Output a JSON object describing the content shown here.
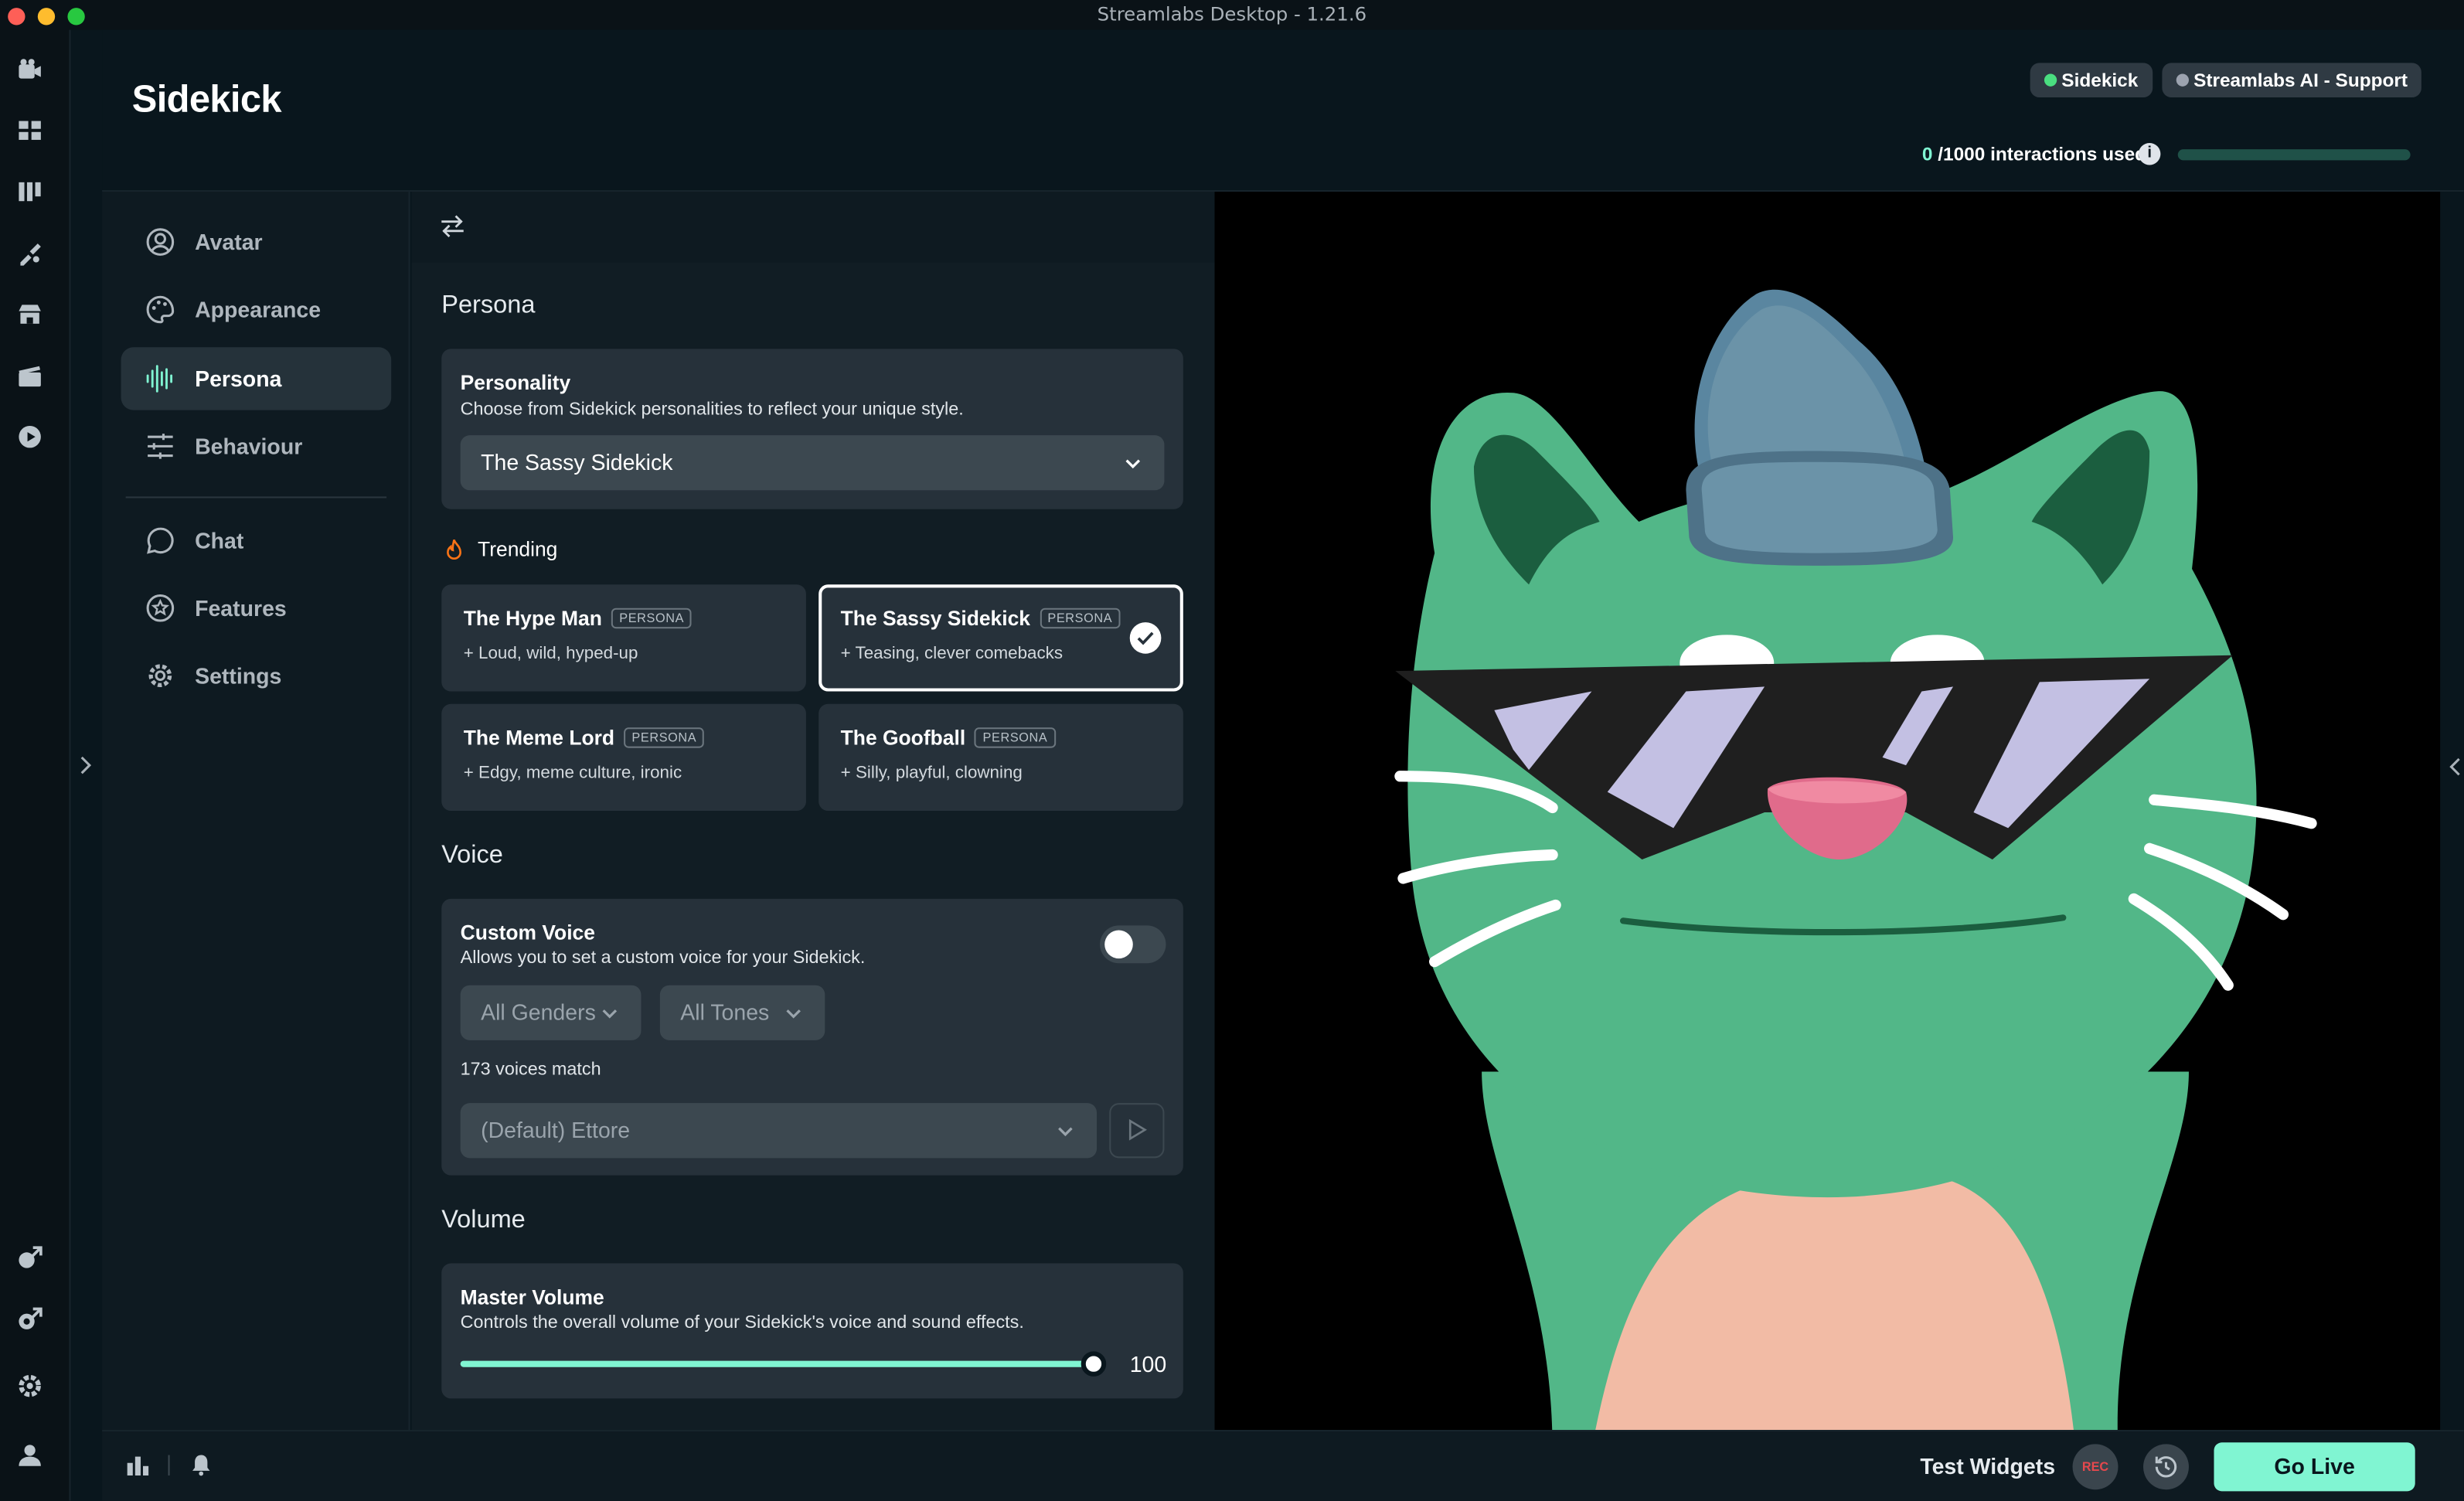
{
  "window": {
    "title": "Streamlabs Desktop - 1.21.6"
  },
  "header": {
    "title": "Sidekick",
    "badges": [
      {
        "label": "Sidekick",
        "dot_color": "#4ade80"
      },
      {
        "label": "Streamlabs AI - Support",
        "dot_color": "#9ca3af"
      }
    ],
    "usage": {
      "count": "0",
      "total_label": " /1000 interactions used",
      "fraction": 0
    }
  },
  "rail": {
    "top_icons": [
      "camera-icon",
      "dashboard-icon",
      "editor-icon",
      "themes-icon",
      "store-icon",
      "studio-icon",
      "recordings-icon"
    ],
    "bottom_icons": [
      "cloud-sync-icon",
      "integrations-icon",
      "settings-icon",
      "profile-icon"
    ]
  },
  "nav": {
    "items": [
      {
        "label": "Avatar",
        "icon": "avatar-icon"
      },
      {
        "label": "Appearance",
        "icon": "palette-icon"
      },
      {
        "label": "Persona",
        "icon": "waveform-icon",
        "active": true
      },
      {
        "label": "Behaviour",
        "icon": "sliders-icon"
      },
      {
        "label": "Chat",
        "icon": "chat-icon"
      },
      {
        "label": "Features",
        "icon": "star-icon"
      },
      {
        "label": "Settings",
        "icon": "gear-icon"
      }
    ]
  },
  "persona": {
    "heading": "Persona",
    "personality": {
      "title": "Personality",
      "subtitle": "Choose from Sidekick personalities to reflect your unique style.",
      "selected": "The Sassy Sidekick"
    },
    "trending": {
      "label": "Trending",
      "tag": "PERSONA",
      "cards": [
        {
          "name": "The Hype Man",
          "desc": "Loud, wild, hyped-up"
        },
        {
          "name": "The Sassy Sidekick",
          "desc": "Teasing, clever comebacks",
          "selected": true
        },
        {
          "name": "The Meme Lord",
          "desc": "Edgy, meme culture, ironic"
        },
        {
          "name": "The Goofball",
          "desc": "Silly, playful, clowning"
        }
      ]
    }
  },
  "voice": {
    "heading": "Voice",
    "custom": {
      "title": "Custom Voice",
      "subtitle": "Allows you to set a custom voice for your Sidekick.",
      "enabled": false
    },
    "gender_filter": "All Genders",
    "tone_filter": "All Tones",
    "match_count": "173 voices match",
    "selected_voice": "(Default) Ettore"
  },
  "volume": {
    "heading": "Volume",
    "title": "Master Volume",
    "subtitle": "Controls the overall volume of your Sidekick's voice and sound effects.",
    "value": "100",
    "level": 1.0
  },
  "footer": {
    "test_widgets": "Test Widgets",
    "rec_label": "REC",
    "go_live": "Go Live"
  },
  "colors": {
    "accent": "#80f5d2",
    "cat_green": "#52b788",
    "hat_blue": "#6b93a8",
    "lens": "#c3c0e3"
  }
}
